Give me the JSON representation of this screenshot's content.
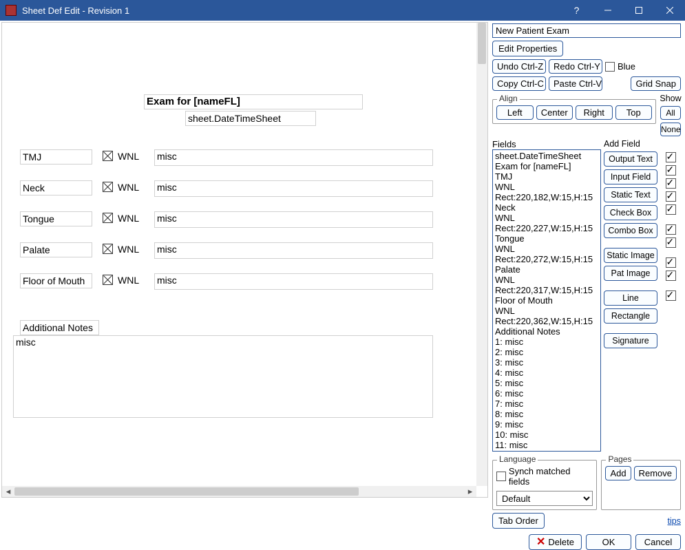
{
  "titlebar": {
    "title": "Sheet Def Edit - Revision 1"
  },
  "right": {
    "sheet_name": "New Patient Exam",
    "edit_properties": "Edit Properties",
    "undo": "Undo Ctrl-Z",
    "redo": "Redo Ctrl-Y",
    "blue_label": "Blue",
    "copy": "Copy Ctrl-C",
    "paste": "Paste Ctrl-V",
    "grid_snap": "Grid Snap",
    "align": {
      "legend": "Align",
      "left": "Left",
      "center": "Center",
      "right": "Right",
      "top": "Top"
    },
    "show": {
      "header": "Show",
      "all": "All",
      "none": "None"
    },
    "addfield": {
      "header": "Add Field",
      "output_text": "Output Text",
      "input_field": "Input Field",
      "static_text": "Static Text",
      "check_box": "Check Box",
      "combo_box": "Combo Box",
      "static_image": "Static Image",
      "pat_image": "Pat Image",
      "line": "Line",
      "rectangle": "Rectangle",
      "signature": "Signature"
    },
    "fields": {
      "legend": "Fields",
      "items": [
        "sheet.DateTimeSheet",
        "Exam for [nameFL]",
        "TMJ",
        "WNL",
        "Rect:220,182,W:15,H:15",
        "Neck",
        "WNL",
        "Rect:220,227,W:15,H:15",
        "Tongue",
        "WNL",
        "Rect:220,272,W:15,H:15",
        "Palate",
        "WNL",
        "Rect:220,317,W:15,H:15",
        "Floor of Mouth",
        "WNL",
        "Rect:220,362,W:15,H:15",
        "Additional Notes",
        "1: misc",
        "2: misc",
        "3: misc",
        "4: misc",
        "5: misc",
        "6: misc",
        "7: misc",
        "8: misc",
        "9: misc",
        "10: misc",
        "11: misc"
      ]
    },
    "language": {
      "legend": "Language",
      "synch": "Synch matched fields",
      "selected": "Default"
    },
    "pages": {
      "legend": "Pages",
      "add": "Add",
      "remove": "Remove"
    },
    "tab_order": "Tab Order",
    "tips": "tips",
    "delete": "Delete",
    "ok": "OK",
    "cancel": "Cancel"
  },
  "canvas": {
    "title": "Exam for [nameFL]",
    "datetime": "sheet.DateTimeSheet",
    "rows": [
      {
        "label": "TMJ",
        "wnl": "WNL",
        "misc": "misc"
      },
      {
        "label": "Neck",
        "wnl": "WNL",
        "misc": "misc"
      },
      {
        "label": "Tongue",
        "wnl": "WNL",
        "misc": "misc"
      },
      {
        "label": "Palate",
        "wnl": "WNL",
        "misc": "misc"
      },
      {
        "label": "Floor of Mouth",
        "wnl": "WNL",
        "misc": "misc"
      }
    ],
    "notes_label": "Additional Notes",
    "notes_misc": "misc"
  }
}
